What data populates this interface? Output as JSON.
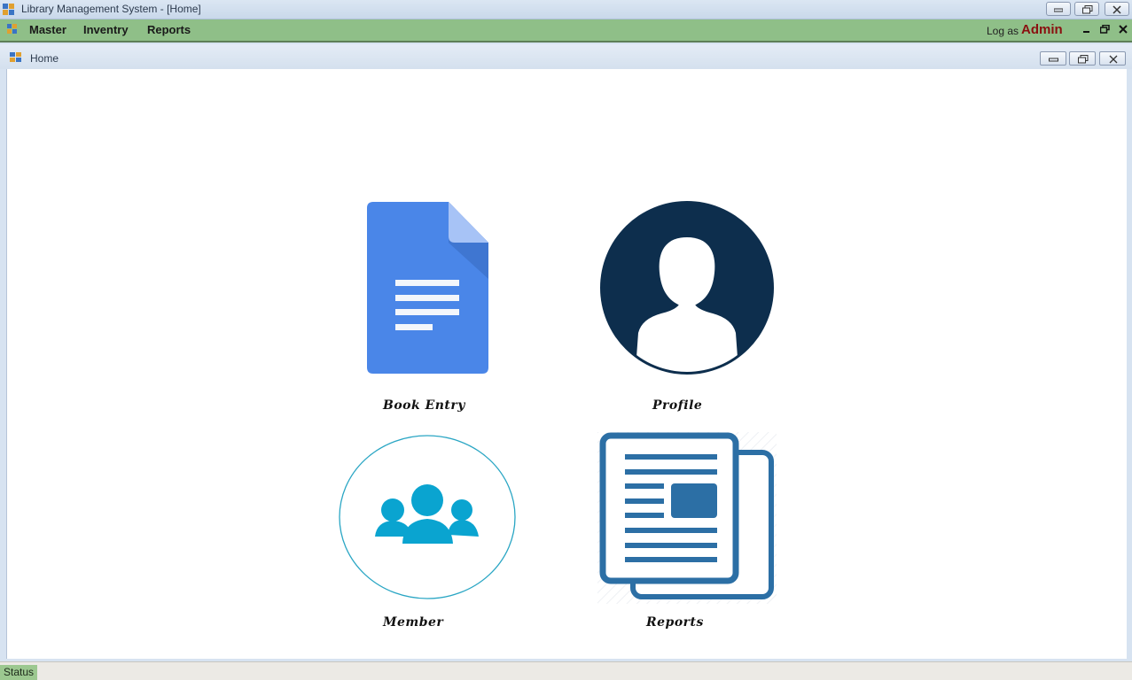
{
  "window": {
    "title": "Library Management System - [Home]",
    "controls": [
      "minimize-icon",
      "restore-icon",
      "close-icon"
    ]
  },
  "menu": {
    "items": [
      {
        "label": "Master"
      },
      {
        "label": "Inventry"
      },
      {
        "label": "Reports"
      }
    ],
    "log_as_label": "Log as",
    "user": "Admin",
    "mdi_controls": [
      "–",
      "🗗",
      "✕"
    ]
  },
  "child_window": {
    "title": "Home"
  },
  "tiles": [
    {
      "label": "Book Entry",
      "icon": "document-icon"
    },
    {
      "label": "Profile",
      "icon": "user-profile-icon"
    },
    {
      "label": "Member",
      "icon": "members-group-icon"
    },
    {
      "label": "Reports",
      "icon": "reports-newspaper-icon"
    }
  ],
  "status": {
    "label": "Status"
  },
  "colors": {
    "menubar": "#8fbf88",
    "admin": "#8a1010",
    "doc_blue": "#4a86e8",
    "profile_navy": "#0d2e4d",
    "member_cyan": "#0aa4d0",
    "reports_blue": "#2c6fa5"
  }
}
